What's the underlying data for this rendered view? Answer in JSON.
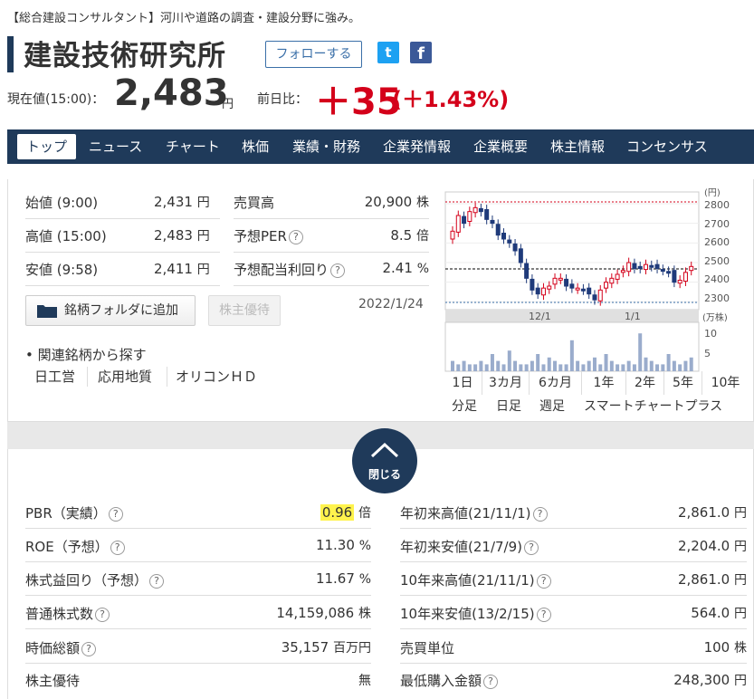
{
  "header": {
    "tagline": "【総合建設コンサルタント】河川や道路の調査・建設分野に強み。",
    "company_name": "建設技術研究所",
    "follow_label": "フォローする",
    "twitter_glyph": "t",
    "facebook_glyph": "f"
  },
  "quote": {
    "price_label": "現在値(15:00)：",
    "price": "2,483",
    "price_unit": "円",
    "change_label": "前日比：",
    "change": "＋35",
    "change_pct": "(＋1.43%)"
  },
  "nav": {
    "items": [
      "トップ",
      "ニュース",
      "チャート",
      "株価",
      "業績・財務",
      "企業発情報",
      "企業概要",
      "株主情報",
      "コンセンサス"
    ]
  },
  "summary": {
    "open": {
      "label": "始値 (9:00)",
      "value": "2,431",
      "unit": "円"
    },
    "high": {
      "label": "高値 (15:00)",
      "value": "2,483",
      "unit": "円"
    },
    "low": {
      "label": "安値 (9:58)",
      "value": "2,411",
      "unit": "円"
    },
    "volume": {
      "label": "売買高",
      "value": "20,900",
      "unit": "株"
    },
    "per": {
      "label": "予想PER",
      "value": "8.5",
      "unit": "倍"
    },
    "dividend": {
      "label": "予想配当利回り",
      "value": "2.41",
      "unit": "%"
    },
    "folder_button": "銘柄フォルダに追加",
    "yutai_button": "株主優待",
    "date": "2022/1/24",
    "related_label": "• 関連銘柄から探す",
    "related": [
      "日工営",
      "応用地質",
      "オリコンＨＤ"
    ],
    "question_glyph": "?"
  },
  "chart": {
    "y_unit": "(円)",
    "y_ticks": [
      "2800",
      "2700",
      "2600",
      "2500",
      "2400",
      "2300"
    ],
    "x_ticks": [
      "12/1",
      "1/1"
    ],
    "vol_unit": "(万株)",
    "vol_ticks": [
      "10",
      "5"
    ],
    "timeframes": [
      "1日",
      "3カ月",
      "6カ月",
      "1年",
      "2年",
      "5年",
      "10年"
    ],
    "subviews": [
      "分足",
      "日足",
      "週足",
      "スマートチャートプラス"
    ]
  },
  "chart_data": {
    "type": "candlestick",
    "y_range": [
      2260,
      2860
    ],
    "closes": [
      2660,
      2740,
      2700,
      2760,
      2780,
      2760,
      2720,
      2700,
      2640,
      2620,
      2600,
      2560,
      2500,
      2420,
      2360,
      2340,
      2370,
      2380,
      2420,
      2420,
      2380,
      2370,
      2370,
      2360,
      2340,
      2310,
      2360,
      2400,
      2420,
      2440,
      2460,
      2500,
      2470,
      2470,
      2490,
      2480,
      2470,
      2460,
      2450,
      2400,
      2410,
      2450,
      2480
    ]
  },
  "close_button": {
    "label": "閉じる",
    "icon": "chevron-up-icon"
  },
  "indicators": {
    "left": [
      {
        "label": "PBR（実績）",
        "value": "0.96",
        "unit": "倍"
      },
      {
        "label": "ROE（予想）",
        "value": "11.30",
        "unit": "%"
      },
      {
        "label": "株式益回り（予想）",
        "value": "11.67",
        "unit": "%"
      },
      {
        "label": "普通株式数",
        "value": "14,159,086",
        "unit": "株"
      },
      {
        "label": "時価総額",
        "value": "35,157",
        "unit": "百万円"
      },
      {
        "label": "株主優待",
        "value": "無",
        "unit": ""
      }
    ],
    "right": [
      {
        "label": "年初来高値(21/11/1)",
        "value": "2,861.0",
        "unit": "円"
      },
      {
        "label": "年初来安値(21/7/9)",
        "value": "2,204.0",
        "unit": "円"
      },
      {
        "label": "10年来高値(21/11/1)",
        "value": "2,861.0",
        "unit": "円"
      },
      {
        "label": "10年来安値(13/2/15)",
        "value": "564.0",
        "unit": "円"
      },
      {
        "label": "売買単位",
        "value": "100",
        "unit": "株"
      },
      {
        "label": "最低購入金額",
        "value": "248,300",
        "unit": "円"
      }
    ]
  }
}
